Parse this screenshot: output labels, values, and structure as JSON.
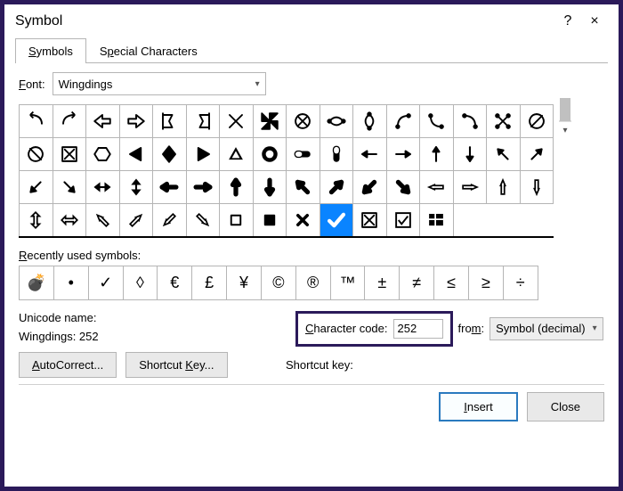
{
  "titlebar": {
    "title": "Symbol",
    "help": "?",
    "close": "×"
  },
  "tabs": {
    "symbols": "Symbols",
    "special": "Special Characters"
  },
  "font": {
    "label": "Font:",
    "value": "Wingdings"
  },
  "grid": {
    "rows": [
      [
        "back-arrow",
        "forward-arrow",
        "back-tab",
        "forward-tab",
        "flag-left",
        "flag-right",
        "x-cross",
        "windmill",
        "cross-circle",
        "loop-h",
        "loop-v",
        "loop-tr",
        "loop-bl",
        "loop-br",
        "cross-arrows",
        "circle-slash"
      ],
      [
        "circle-slash-left",
        "box-x",
        "hexagon",
        "triangle-left",
        "diamond-up",
        "triangle-right",
        "triangle-ring",
        "target",
        "pill-lr",
        "pill-ud",
        "arrow-left",
        "arrow-right",
        "arrow-up",
        "arrow-down",
        "arrow-ul",
        "arrow-ur"
      ],
      [
        "arrow-dl",
        "arrow-dr",
        "arrow-lr",
        "arrow-ud",
        "arrow-bold-left",
        "arrow-bold-right",
        "arrow-bold-up",
        "arrow-bold-down",
        "arrow-bold-ul",
        "arrow-bold-ur",
        "arrow-bold-dl",
        "arrow-bold-dr",
        "arrow-outline-left",
        "arrow-outline-right",
        "arrow-outline-up",
        "arrow-outline-down"
      ],
      [
        "arrow-outline-ud",
        "arrow-outline-lr",
        "arrow-outline-ul",
        "arrow-outline-ur",
        "arrow-outline-dl",
        "arrow-outline-dr",
        "sq-outline",
        "sq-filled",
        "x-small",
        "checkmark",
        "box-x2",
        "box-check",
        "windows-logo",
        "",
        "",
        ""
      ]
    ],
    "selected": [
      3,
      9
    ]
  },
  "recent_label": "Recently used symbols:",
  "recent": [
    "💣",
    "•",
    "✓",
    "◊",
    "€",
    "£",
    "¥",
    "©",
    "®",
    "™",
    "±",
    "≠",
    "≤",
    "≥",
    "÷"
  ],
  "unicode_name_label": "Unicode name:",
  "unicode_name": "Wingdings: 252",
  "char_code": {
    "label": "Character code:",
    "value": "252"
  },
  "from": {
    "label": "from:",
    "value": "Symbol (decimal)"
  },
  "autocorrect": "AutoCorrect...",
  "shortcut_btn": "Shortcut Key...",
  "shortcut_label": "Shortcut key:",
  "insert": "Insert",
  "close_btn": "Close"
}
